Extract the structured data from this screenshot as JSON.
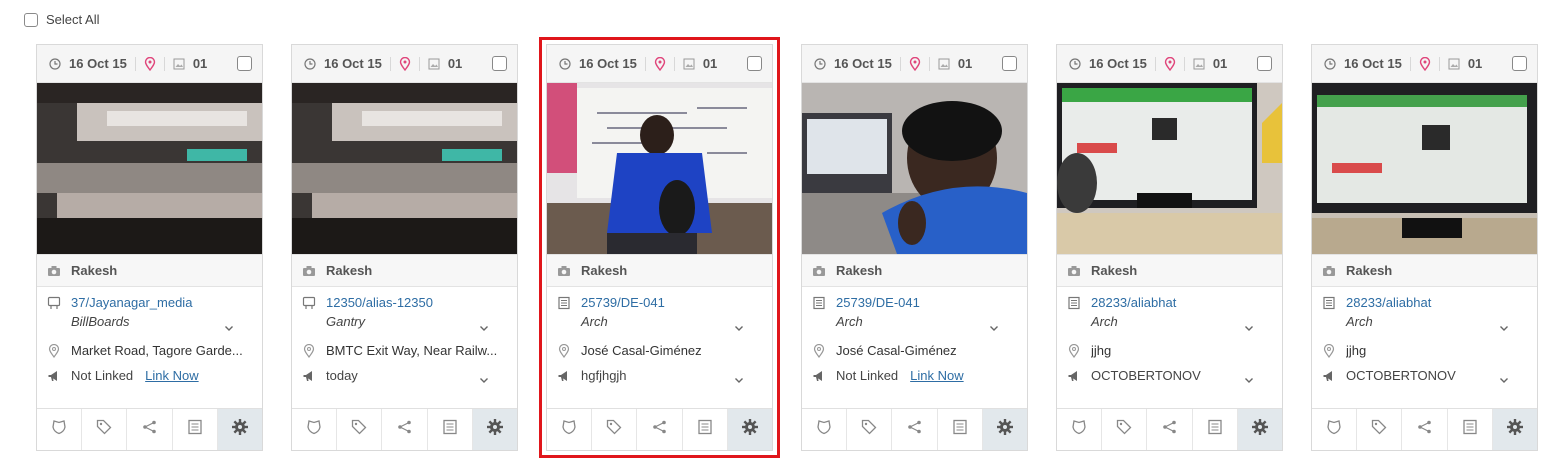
{
  "select_all_label": "Select All",
  "colors": {
    "link": "#2e6da4",
    "selected_border": "#e0161b",
    "pin": "#e0457b"
  },
  "cards": [
    {
      "date": "16 Oct 15",
      "count": "01",
      "author": "Rakesh",
      "media_type_icon": "billboard-icon",
      "media_link": "37/Jayanagar_media",
      "media_subtype": "BillBoards",
      "location": "Market Road, Tagore Garde...",
      "campaign_icon": "megaphone-icon",
      "campaign": "Not Linked",
      "campaign_link": "Link Now",
      "selected": false
    },
    {
      "date": "16 Oct 15",
      "count": "01",
      "author": "Rakesh",
      "media_type_icon": "billboard-icon",
      "media_link": "12350/alias-12350",
      "media_subtype": "Gantry",
      "location": "BMTC Exit Way, Near Railw...",
      "campaign_icon": "megaphone-icon",
      "campaign": "today",
      "campaign_link": "",
      "selected": false
    },
    {
      "date": "16 Oct 15",
      "count": "01",
      "author": "Rakesh",
      "media_type_icon": "document-icon",
      "media_link": "25739/DE-041",
      "media_subtype": "Arch",
      "location": "José Casal-Giménez",
      "campaign_icon": "megaphone-icon",
      "campaign": "hgfjhgjh",
      "campaign_link": "",
      "selected": true
    },
    {
      "date": "16 Oct 15",
      "count": "01",
      "author": "Rakesh",
      "media_type_icon": "document-icon",
      "media_link": "25739/DE-041",
      "media_subtype": "Arch",
      "location": "José Casal-Giménez",
      "campaign_icon": "megaphone-icon",
      "campaign": "Not Linked",
      "campaign_link": "Link Now",
      "selected": false
    },
    {
      "date": "16 Oct 15",
      "count": "01",
      "author": "Rakesh",
      "media_type_icon": "document-icon",
      "media_link": "28233/aliabhat",
      "media_subtype": "Arch",
      "location": "jjhg",
      "campaign_icon": "megaphone-icon",
      "campaign": "OCTOBERTONOV",
      "campaign_link": "",
      "selected": false
    },
    {
      "date": "16 Oct 15",
      "count": "01",
      "author": "Rakesh",
      "media_type_icon": "document-icon",
      "media_link": "28233/aliabhat",
      "media_subtype": "Arch",
      "location": "jjhg",
      "campaign_icon": "megaphone-icon",
      "campaign": "OCTOBERTONOV",
      "campaign_link": "",
      "selected": false
    }
  ],
  "action_icons": [
    "badge-icon",
    "tag-icon",
    "share-icon",
    "notes-icon",
    "settings-gear-icon"
  ]
}
